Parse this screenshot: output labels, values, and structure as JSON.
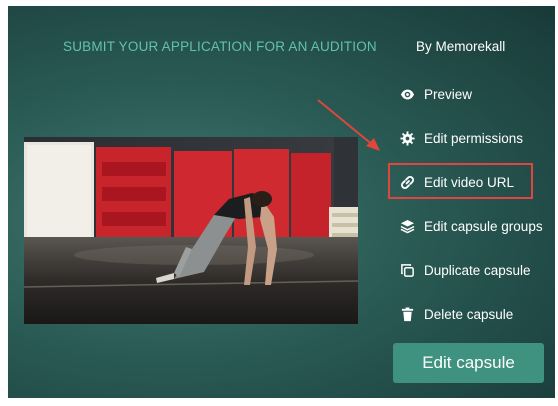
{
  "header": {
    "title": "SUBMIT YOUR APPLICATION FOR AN AUDITION",
    "author": "By Memorekall"
  },
  "menu": {
    "preview": "Preview",
    "edit_permissions": "Edit permissions",
    "edit_video_url": "Edit video URL",
    "edit_capsule_groups": "Edit capsule groups",
    "duplicate_capsule": "Duplicate capsule",
    "delete_capsule": "Delete capsule"
  },
  "actions": {
    "edit_capsule": "Edit capsule"
  },
  "colors": {
    "title": "#63c1a9",
    "accent_button": "#3e927f",
    "highlight": "#e0463b",
    "panel": "#2a5a54"
  },
  "icons": [
    "eye-icon",
    "gear-icon",
    "link-icon",
    "layers-icon",
    "copy-icon",
    "trash-icon"
  ]
}
